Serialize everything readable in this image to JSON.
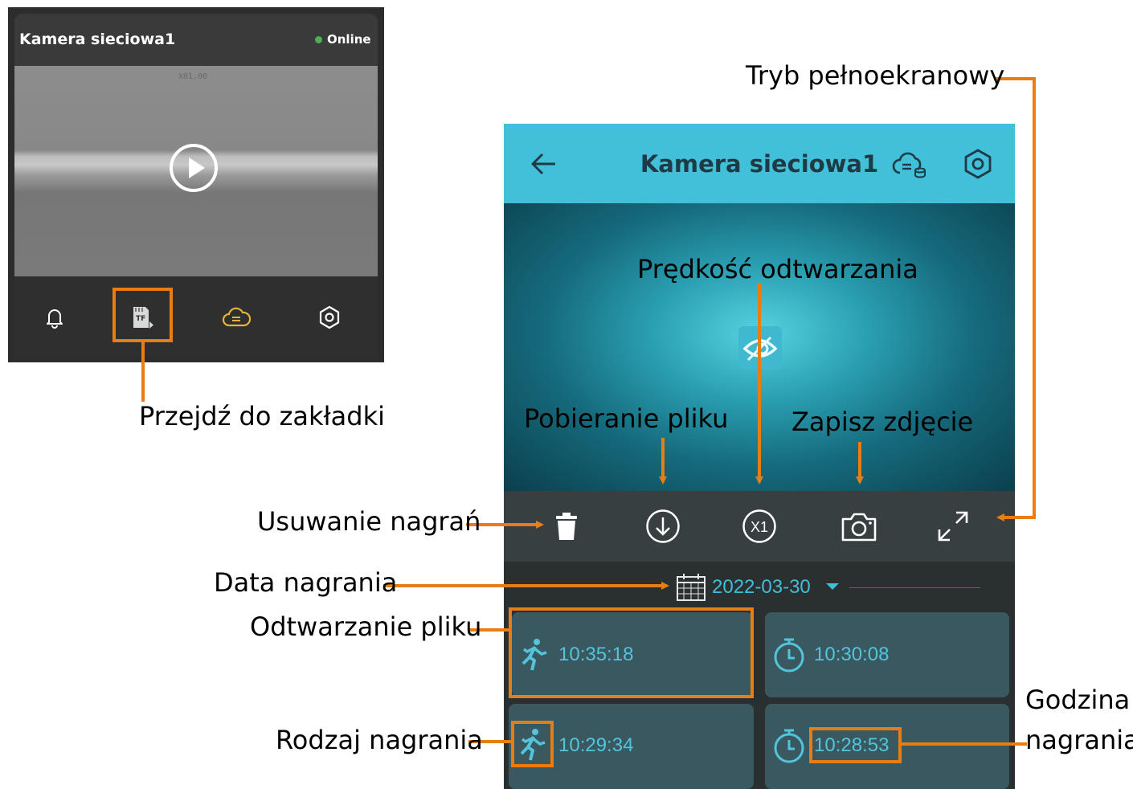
{
  "left_screen": {
    "title": "Kamera sieciowa1",
    "status": "Online",
    "osd": "X01.00",
    "tabs": [
      "bell-icon",
      "tf-card-playback-icon",
      "cloud-icon",
      "settings-icon"
    ]
  },
  "right_screen": {
    "title": "Kamera sieciowa1",
    "toolbar": [
      "delete-icon",
      "download-icon",
      "speed-x1-icon",
      "camera-icon",
      "fullscreen-icon"
    ],
    "speed_label": "X1",
    "date": "2022-03-30",
    "recordings": [
      {
        "time": "10:35:18",
        "type": "motion"
      },
      {
        "time": "10:30:08",
        "type": "timer"
      },
      {
        "time": "10:29:34",
        "type": "motion"
      },
      {
        "time": "10:28:53",
        "type": "timer"
      }
    ]
  },
  "annotations": {
    "go_to_tab": "Przejdź do zakładki",
    "fullscreen": "Tryb pełnoekranowy",
    "playback_speed": "Prędkość odtwarzania",
    "file_download": "Pobieranie pliku",
    "save_photo": "Zapisz zdjęcie",
    "delete_recordings": "Usuwanie nagrań",
    "recording_date": "Data nagrania",
    "play_file": "Odtwarzanie pliku",
    "recording_time_1": "Godzina",
    "recording_time_2": "nagrania",
    "recording_type": "Rodzaj nagrania"
  },
  "colors": {
    "accent_orange": "#e87d14",
    "header_cyan": "#42bfd9",
    "online_green": "#4caf50"
  }
}
